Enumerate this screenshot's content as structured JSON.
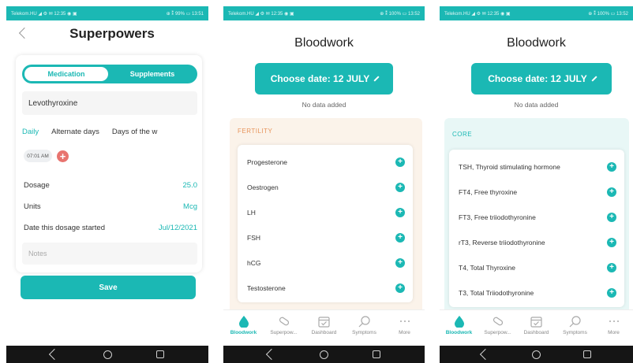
{
  "colors": {
    "accent": "#1bb8b4",
    "accent_light": "#e8f7f6",
    "fertility_bg": "#fbf3ea",
    "fertility_label": "#e7945c",
    "danger": "#e8746f"
  },
  "screen1": {
    "status_left": "Telekom.HU ◢ ⚙ ✉ 12:35 ◉ ▣",
    "status_right": "⊕ ⁑ 99% ▭ 13:51",
    "title": "Superpowers",
    "tabs": {
      "medication": "Medication",
      "supplements": "Supplements"
    },
    "medication_name": "Levothyroxine",
    "frequency": [
      "Daily",
      "Alternate days",
      "Days of the w"
    ],
    "time": "07:01 AM",
    "rows": [
      {
        "label": "Dosage",
        "value": "25.0"
      },
      {
        "label": "Units",
        "value": "Mcg"
      },
      {
        "label": "Date this dosage started",
        "value": "Jul/12/2021"
      }
    ],
    "notes_placeholder": "Notes",
    "save_label": "Save"
  },
  "screen2": {
    "status_left": "Telekom.HU ◢ ⚙ ✉ 12:35 ◉ ▣",
    "status_right": "⊕ ⁑ 100% ▭ 13:52",
    "title": "Bloodwork",
    "date_label": "Choose date: 12 JULY",
    "no_data": "No data added",
    "section": "FERTILITY",
    "items": [
      "Progesterone",
      "Oestrogen",
      "LH",
      "FSH",
      "hCG",
      "Testosterone"
    ]
  },
  "screen3": {
    "status_left": "Telekom.HU ◢ ⚙ ✉ 12:35 ◉ ▣",
    "status_right": "⊕ ⁑ 100% ▭ 13:52",
    "title": "Bloodwork",
    "date_label": "Choose date: 12 JULY",
    "no_data": "No data added",
    "section": "CORE",
    "items": [
      "TSH, Thyroid stimulating hormone",
      "FT4, Free thyroxine",
      "FT3, Free triiodothyronine",
      "rT3, Reverse triiodothyronine",
      "T4, Total Thyroxine",
      "T3, Total Triiodothyronine"
    ]
  },
  "tabbar": [
    "Bloodwork",
    "Superpow...",
    "Dashboard",
    "Symptoms",
    "More"
  ]
}
